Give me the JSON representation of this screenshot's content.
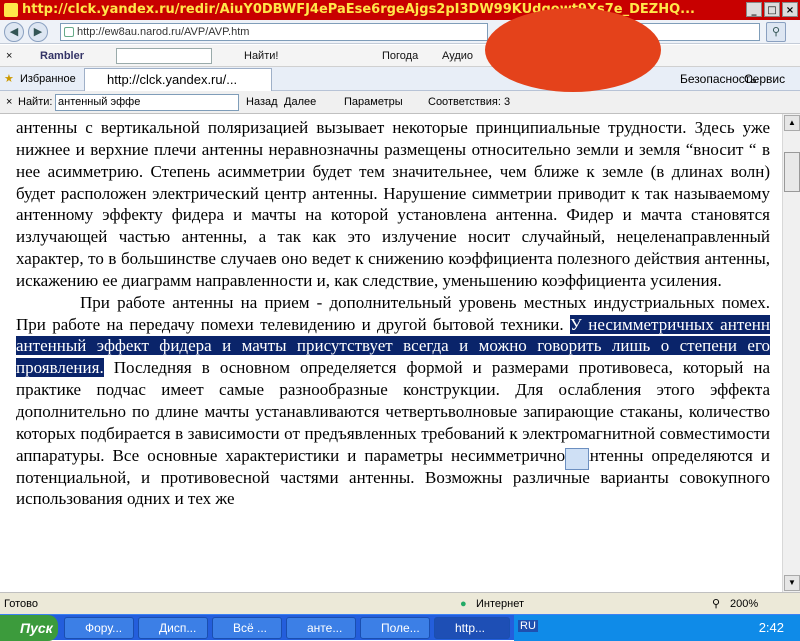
{
  "window": {
    "title": "http://clck.yandex.ru/redir/AiuY0DBWFJ4ePaEse6rgeAjgs2pI3DW99KUdgowt9Xs7e_DEZHQ..."
  },
  "address_bar": {
    "url": "http://ew8au.narod.ru/AVP/AVP.htm"
  },
  "rambler_toolbar": {
    "brand": "Rambler",
    "find_label": "Найти!",
    "weather": "Погода",
    "audio": "Аудио"
  },
  "tabs_bar": {
    "favorites": "Избранное",
    "tab_label": "http://clck.yandex.ru/...",
    "safety": "Безопасность",
    "service": "Сервис"
  },
  "find_bar": {
    "find_label": "Найти:",
    "query": "антенный эффе",
    "prev": "Назад",
    "next": "Далее",
    "options": "Параметры",
    "matches": "Соответствия: 3"
  },
  "document": {
    "p1": "антенны с вертикальной поляризацией вызывает некоторые принципиальные трудности. Здесь уже нижнее и верхние плечи антенны неравнозначны размещены относительно земли и земля “вносит “ в нее асимметрию. Степень асимметрии будет тем значительнее, чем ближе к земле (в длинах волн) будет расположен электрический центр антенны. Нарушение симметрии приводит к так называемому антенному эффекту фидера и мачты на которой установлена антенна. Фидер и мачта становятся излучающей частью антенны, а так как это излучение носит случайный, нецеленаправленный характер, то в большинстве случаев оно ведет к снижению коэффициента полезного действия антенны, искажению ее диаграмм направленности и, как следствие, уменьшению коэффициента усиления.",
    "p2_before": "При работе антенны на прием - дополнительный уровень местных индустриальных помех. При работе на передачу помехи телевидению и другой бытовой техники. ",
    "p2_highlight": "У несимметричных антенн антенный эффект фидера и мачты присутствует всегда и можно говорить лишь о степени его проявления.",
    "p2_after": " Последняя в основном определяется формой и размерами противовеса, который на практике подчас имеет самые разнообразные конструкции. Для ослабления этого эффекта дополнительно по длине мачты устанавливаются четвертьволновые запирающие стаканы, количество которых подбирается в зависимости от предъявленных требований к электромагнитной совместимости аппаратуры. Все основные характеристики и параметры несимметричной антенны определяются и потенциальной, и противовесной частями антенны. Возможны различные варианты совокупного использования одних и тех же"
  },
  "status_bar": {
    "left": "Готово",
    "zone": "Интернет",
    "zoom": "200%"
  },
  "taskbar": {
    "start": "Пуск",
    "buttons": [
      "Фору...",
      "Дисп...",
      "Всё ...",
      "анте...",
      "Поле...",
      "http..."
    ],
    "lang": "RU",
    "clock": "2:42"
  }
}
